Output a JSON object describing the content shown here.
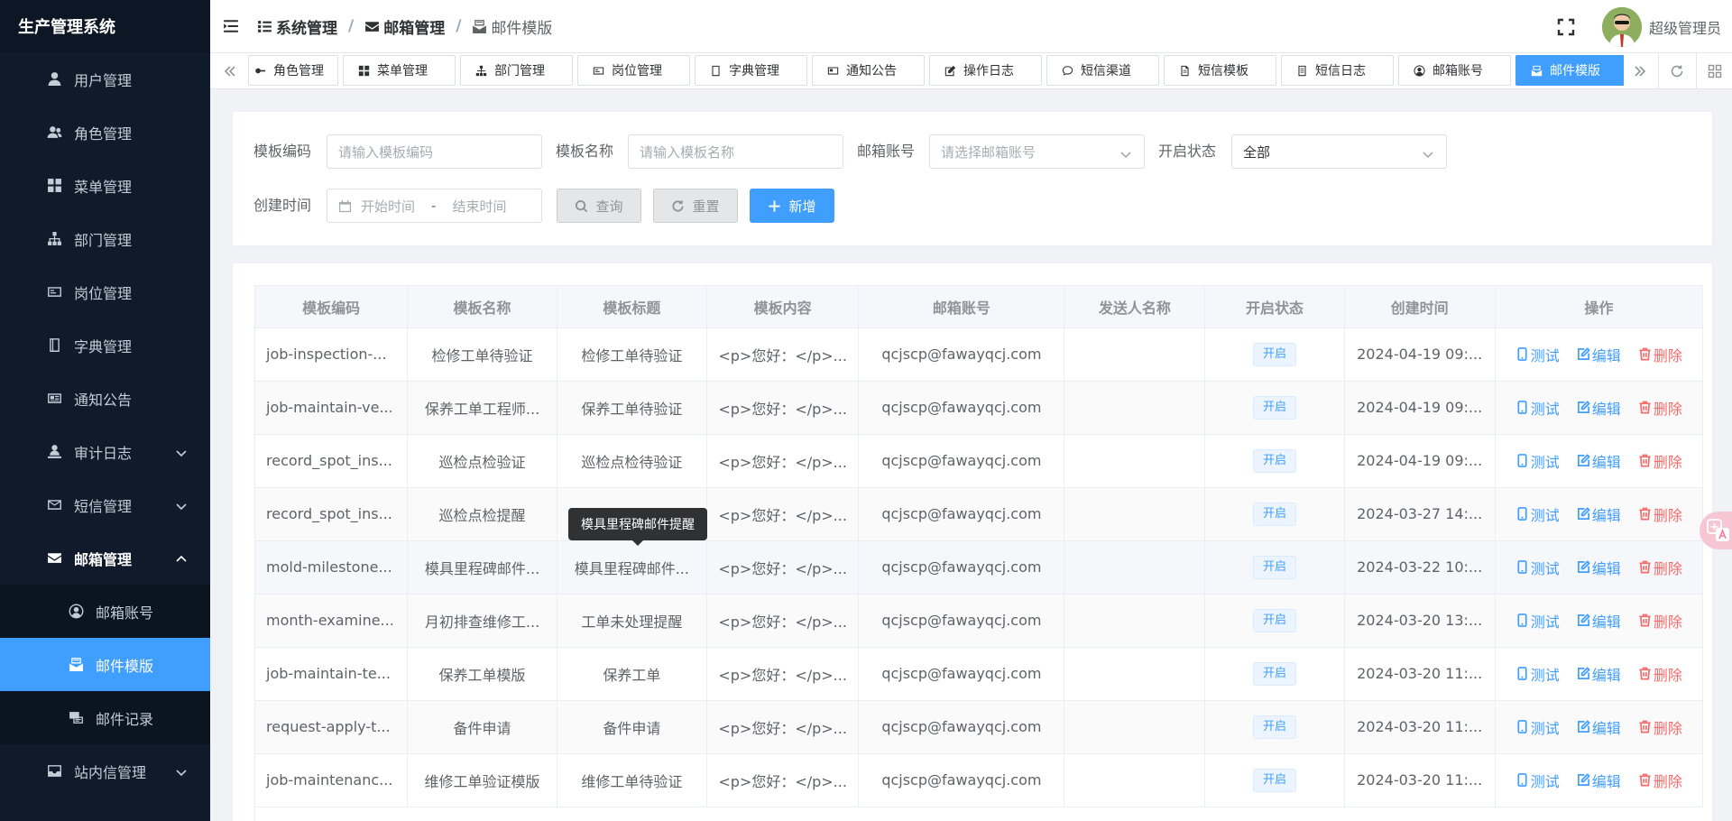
{
  "app": {
    "title": "生产管理系统"
  },
  "sidebar": {
    "items": [
      {
        "label": "用户管理",
        "icon": "user-icon"
      },
      {
        "label": "角色管理",
        "icon": "users-icon"
      },
      {
        "label": "菜单管理",
        "icon": "grid-icon"
      },
      {
        "label": "部门管理",
        "icon": "sitemap-icon"
      },
      {
        "label": "岗位管理",
        "icon": "id-card-icon"
      },
      {
        "label": "字典管理",
        "icon": "book-icon"
      },
      {
        "label": "通知公告",
        "icon": "news-icon"
      },
      {
        "label": "审计日志",
        "icon": "audit-icon"
      },
      {
        "label": "短信管理",
        "icon": "envelope-outline-icon"
      },
      {
        "label": "邮箱管理",
        "icon": "envelope-icon"
      },
      {
        "label": "站内信管理",
        "icon": "inbox-icon"
      }
    ],
    "mail_sub": [
      {
        "label": "邮箱账号",
        "icon": "account-circle-icon"
      },
      {
        "label": "邮件模版",
        "icon": "mail-template-icon"
      },
      {
        "label": "邮件记录",
        "icon": "mail-record-icon"
      }
    ]
  },
  "header": {
    "crumbs": [
      {
        "label": "系统管理",
        "icon": "list-icon"
      },
      {
        "label": "邮箱管理",
        "icon": "envelope-icon"
      },
      {
        "label": "邮件模版",
        "icon": "mail-template-icon"
      }
    ],
    "user": "超级管理员"
  },
  "tags": [
    {
      "label": "角色管理"
    },
    {
      "label": "菜单管理"
    },
    {
      "label": "部门管理"
    },
    {
      "label": "岗位管理"
    },
    {
      "label": "字典管理"
    },
    {
      "label": "通知公告"
    },
    {
      "label": "操作日志"
    },
    {
      "label": "短信渠道"
    },
    {
      "label": "短信模板"
    },
    {
      "label": "短信日志"
    },
    {
      "label": "邮箱账号"
    },
    {
      "label": "邮件模版"
    }
  ],
  "search": {
    "code_label": "模板编码",
    "code_placeholder": "请输入模板编码",
    "name_label": "模板名称",
    "name_placeholder": "请输入模板名称",
    "account_label": "邮箱账号",
    "account_placeholder": "请选择邮箱账号",
    "status_label": "开启状态",
    "status_value": "全部",
    "time_label": "创建时间",
    "start_placeholder": "开始时间",
    "end_placeholder": "结束时间",
    "dash": "-",
    "query_btn": "查询",
    "reset_btn": "重置",
    "add_btn": "新增"
  },
  "table": {
    "headers": [
      "模板编码",
      "模板名称",
      "模板标题",
      "模板内容",
      "邮箱账号",
      "发送人名称",
      "开启状态",
      "创建时间",
      "操作"
    ],
    "ops": {
      "test": "测试",
      "edit": "编辑",
      "delete": "删除"
    },
    "rows": [
      {
        "code": "job-inspection-...",
        "name": "检修工单待验证",
        "title": "检修工单待验证",
        "content": "<p>您好：</p>...",
        "account": "qcjscp@fawayqcj.com",
        "sender": "",
        "status": "开启",
        "time": "2024-04-19 09:..."
      },
      {
        "code": "job-maintain-ve...",
        "name": "保养工单工程师...",
        "title": "保养工单待验证",
        "content": "<p>您好：</p>...",
        "account": "qcjscp@fawayqcj.com",
        "sender": "",
        "status": "开启",
        "time": "2024-04-19 09:..."
      },
      {
        "code": "record_spot_ins...",
        "name": "巡检点检验证",
        "title": "巡检点检待验证",
        "content": "<p>您好：</p>...",
        "account": "qcjscp@fawayqcj.com",
        "sender": "",
        "status": "开启",
        "time": "2024-04-19 09:..."
      },
      {
        "code": "record_spot_ins...",
        "name": "巡检点检提醒",
        "title": "",
        "content": "<p>您好：</p>...",
        "account": "qcjscp@fawayqcj.com",
        "sender": "",
        "status": "开启",
        "time": "2024-03-27 14:..."
      },
      {
        "code": "mold-milestone...",
        "name": "模具里程碑邮件...",
        "title": "模具里程碑邮件...",
        "content": "<p>您好：</p>...",
        "account": "qcjscp@fawayqcj.com",
        "sender": "",
        "status": "开启",
        "time": "2024-03-22 10:..."
      },
      {
        "code": "month-examine...",
        "name": "月初排查维修工...",
        "title": "工单未处理提醒",
        "content": "<p>您好：</p>...",
        "account": "qcjscp@fawayqcj.com",
        "sender": "",
        "status": "开启",
        "time": "2024-03-20 13:..."
      },
      {
        "code": "job-maintain-te...",
        "name": "保养工单模版",
        "title": "保养工单",
        "content": "<p>您好：</p>...",
        "account": "qcjscp@fawayqcj.com",
        "sender": "",
        "status": "开启",
        "time": "2024-03-20 11:..."
      },
      {
        "code": "request-apply-t...",
        "name": "备件申请",
        "title": "备件申请",
        "content": "<p>您好：</p>...",
        "account": "qcjscp@fawayqcj.com",
        "sender": "",
        "status": "开启",
        "time": "2024-03-20 11:..."
      },
      {
        "code": "job-maintenanc...",
        "name": "维修工单验证模版",
        "title": "维修工单待验证",
        "content": "<p>您好：</p>...",
        "account": "qcjscp@fawayqcj.com",
        "sender": "",
        "status": "开启",
        "time": "2024-03-20 11:..."
      }
    ]
  },
  "tooltip": "模具里程碑邮件提醒",
  "colors": {
    "primary": "#409eff",
    "sidebar_bg": "#0f1b2b",
    "danger": "#f56c6c"
  }
}
